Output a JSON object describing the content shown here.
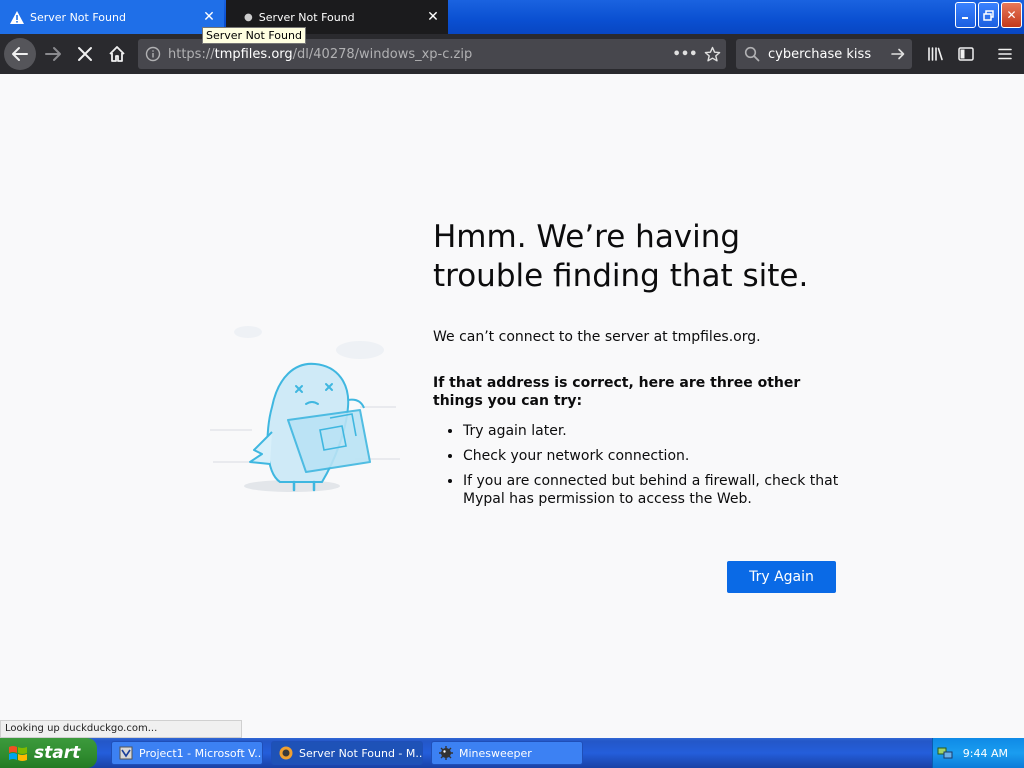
{
  "browser": {
    "tabs": [
      {
        "label": "Server Not Found",
        "active": true
      },
      {
        "label": "Server Not Found",
        "active": false
      }
    ],
    "tooltip": "Server Not Found",
    "url": {
      "prefix": "https://",
      "host": "tmpfiles.org",
      "path": "/dl/40278/windows_xp-c.zip"
    },
    "search": {
      "value": "cyberchase kiss"
    },
    "status": "Looking up duckduckgo.com..."
  },
  "error_page": {
    "title": "Hmm. We’re having trouble finding that site.",
    "description": "We can’t connect to the server at tmpfiles.org.",
    "subtitle": "If that address is correct, here are three other things you can try:",
    "suggestions": [
      "Try again later.",
      "Check your network connection.",
      "If you are connected but behind a firewall, check that Mypal has permission to access the Web."
    ],
    "button_label": "Try Again"
  },
  "taskbar": {
    "start_label": "start",
    "tasks": [
      {
        "label": "Project1 - Microsoft V...",
        "icon": "visual-basic-icon"
      },
      {
        "label": "Server Not Found - M...",
        "icon": "mypal-icon",
        "active": true
      },
      {
        "label": "Minesweeper",
        "icon": "minesweeper-icon"
      }
    ],
    "clock": "9:44 AM"
  },
  "colors": {
    "accent": "#0a6ae6",
    "toolbar": "#2a2a2e",
    "taskbar": "#245edb"
  }
}
